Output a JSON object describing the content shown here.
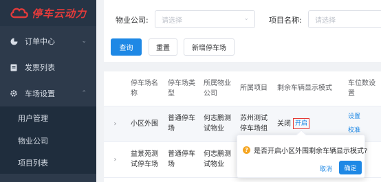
{
  "brand": {
    "name": "停车云动力",
    "color": "#e23b3b"
  },
  "sidebar": {
    "items": [
      {
        "label": "订单中心",
        "icon": "pie-chart-icon"
      },
      {
        "label": "发票列表",
        "icon": "document-icon"
      },
      {
        "label": "车场设置",
        "icon": "gear-icon",
        "expanded": true,
        "children": [
          {
            "label": "用户管理"
          },
          {
            "label": "物业公司"
          },
          {
            "label": "项目列表"
          }
        ]
      }
    ]
  },
  "filters": {
    "property_label": "物业公司:",
    "property_placeholder": "请选择",
    "project_label": "项目名称:",
    "project_placeholder": "请选择"
  },
  "buttons": {
    "search": "查询",
    "reset": "重置",
    "add": "新增停车场"
  },
  "table": {
    "headers": [
      "停车场名称",
      "停车场类型",
      "所属物业公司",
      "所属项目",
      "剩余车辆显示模式",
      "车位数设置"
    ],
    "rows": [
      {
        "name": "小区外围",
        "type": "普通停车场",
        "company": "何志鹏测试物业",
        "project": "苏州测试停车场组",
        "mode_status": "关闭",
        "mode_action": "开启",
        "links": [
          "设置",
          "校准"
        ]
      },
      {
        "name": "益景苑测试停车场",
        "type": "普通停车场",
        "company": "何志鹏测试物业",
        "project": "",
        "mode_status": "",
        "mode_action": "",
        "links": []
      }
    ]
  },
  "popconfirm": {
    "message": "是否开启小区外围剩余车辆显示模式?",
    "cancel": "取消",
    "confirm": "确定"
  },
  "colors": {
    "sidebar_bg": "#2d3a4b",
    "primary": "#1e88e5",
    "warning": "#f5a623",
    "highlight_border": "#e53935"
  }
}
